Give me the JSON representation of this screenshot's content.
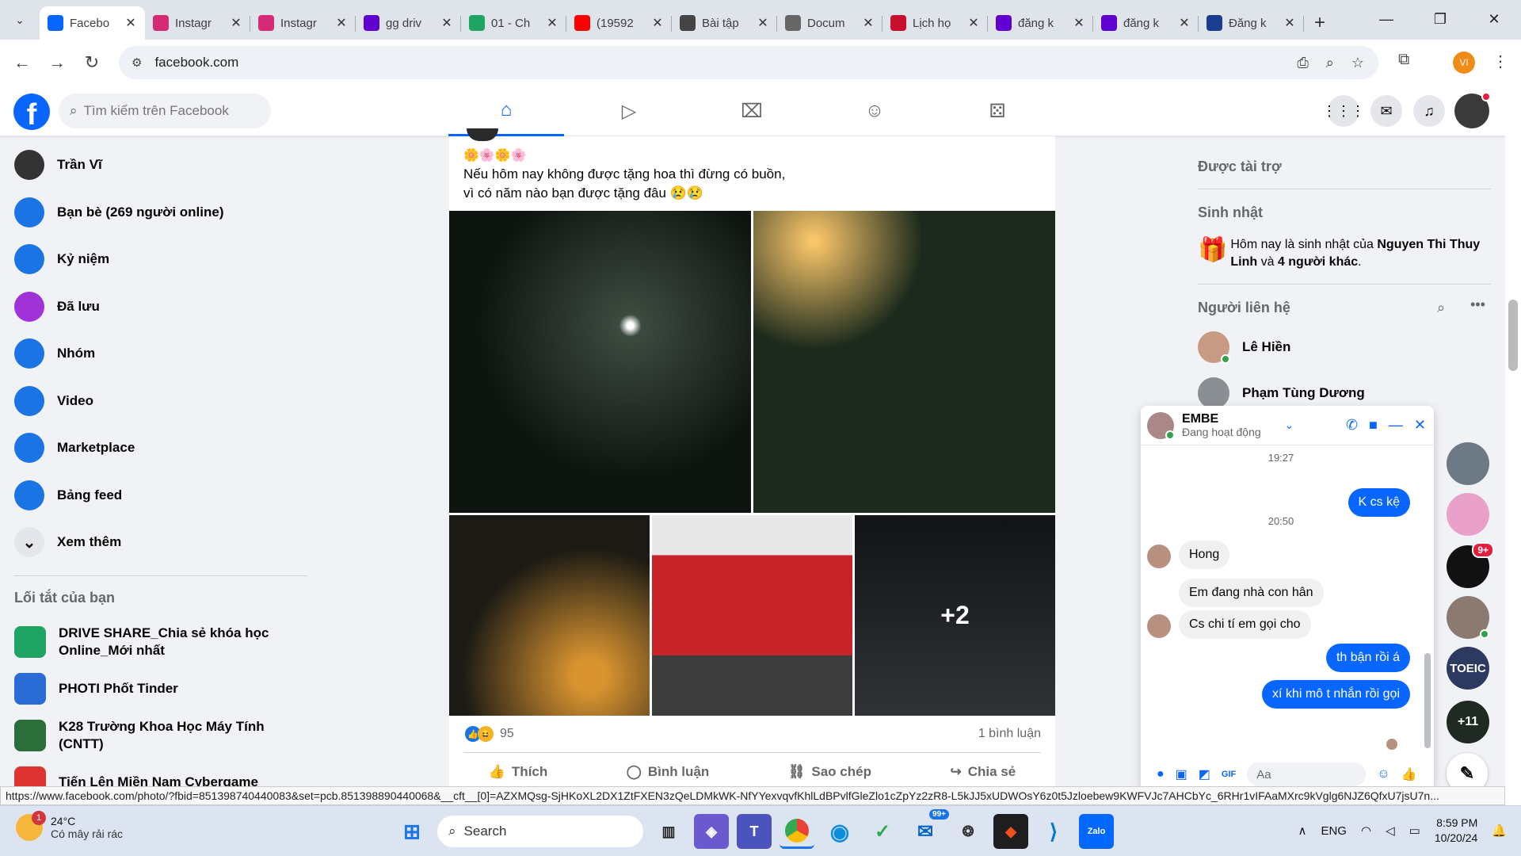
{
  "browser": {
    "tabs": [
      {
        "title": "Facebo",
        "icon": "facebook-icon",
        "color": "#0866ff",
        "active": true
      },
      {
        "title": "Instagr",
        "icon": "instagram-icon",
        "color": "#d62976"
      },
      {
        "title": "Instagr",
        "icon": "instagram-icon",
        "color": "#d62976"
      },
      {
        "title": "gg driv",
        "icon": "yahoo-icon",
        "color": "#6001d2"
      },
      {
        "title": "01 - Ch",
        "icon": "drive-icon",
        "color": "#1fa463"
      },
      {
        "title": "(19592",
        "icon": "youtube-icon",
        "color": "#ff0000"
      },
      {
        "title": "Bài tập",
        "icon": "openai-icon",
        "color": "#444444"
      },
      {
        "title": "Docum",
        "icon": "globe-icon",
        "color": "#666666"
      },
      {
        "title": "Lịch họ",
        "icon": "calendar-icon",
        "color": "#c8102e"
      },
      {
        "title": "đăng k",
        "icon": "yahoo-icon",
        "color": "#6001d2"
      },
      {
        "title": "đăng k",
        "icon": "yahoo-icon",
        "color": "#6001d2"
      },
      {
        "title": "Đăng k",
        "icon": "site-icon",
        "color": "#1a3d8f"
      }
    ],
    "url": "facebook.com",
    "profile_initial": "VI",
    "status_url": "https://www.facebook.com/photo/?fbid=851398740440083&set=pcb.851398890440068&__cft__[0]=AZXMQsg-SjHKoXL2DX1ZtFXEN3zQeLDMkWK-NfYYexvqvfKhlLdBPvlfGleZlo1cZpYz2zR8-L5kJJ5xUDWOsY6z0t5Jzloebew9KWFVJc7AHCbYc_6RHr1vIFAaMXrc9kVglg6NJZ6QfxU7jsU7n..."
  },
  "fb": {
    "search_placeholder": "Tìm kiếm trên Facebook",
    "nav": [
      "home-icon",
      "video-icon",
      "marketplace-icon",
      "groups-icon",
      "gaming-icon"
    ]
  },
  "left_nav": {
    "items": [
      {
        "label": "Trần Vĩ",
        "icon": "profile-avatar",
        "color": "#333333"
      },
      {
        "label": "Bạn bè (269 người online)",
        "icon": "friends-icon",
        "color": "#1b74e4"
      },
      {
        "label": "Kỷ niệm",
        "icon": "memories-icon",
        "color": "#1b74e4"
      },
      {
        "label": "Đã lưu",
        "icon": "saved-icon",
        "color": "#a033d8"
      },
      {
        "label": "Nhóm",
        "icon": "groups-icon",
        "color": "#1b74e4"
      },
      {
        "label": "Video",
        "icon": "video-icon",
        "color": "#1b74e4"
      },
      {
        "label": "Marketplace",
        "icon": "marketplace-icon",
        "color": "#1b74e4"
      },
      {
        "label": "Bảng feed",
        "icon": "feeds-icon",
        "color": "#1b74e4"
      },
      {
        "label": "Xem thêm",
        "icon": "chevron-down-icon",
        "color": "#e4e6eb"
      }
    ],
    "shortcuts_title": "Lối tắt của bạn",
    "shortcuts": [
      {
        "label": "DRIVE SHARE_Chia sẻ khóa học Online_Mới nhất",
        "color": "#1fa463"
      },
      {
        "label": "PHOTI Phốt Tinder",
        "color": "#2a6bd6"
      },
      {
        "label": "K28 Trường Khoa Học Máy Tính (CNTT)",
        "color": "#2c6e3a"
      },
      {
        "label": "Tiến Lên Miền Nam Cybergame",
        "color": "#d33"
      }
    ]
  },
  "post": {
    "emoji": "🌼🌸🌼🌸",
    "caption_line1": "Nếu hôm nay không được tặng hoa thì đừng có buồn,",
    "caption_line2": "vì có năm nào bạn được tặng đâu 😢😢",
    "more_photos": "+2",
    "reaction_count": "95",
    "comments": "1 bình luận",
    "actions": [
      {
        "label": "Thích",
        "icon": "like-icon"
      },
      {
        "label": "Bình luận",
        "icon": "comment-icon"
      },
      {
        "label": "Sao chép",
        "icon": "copy-link-icon"
      },
      {
        "label": "Chia sẻ",
        "icon": "share-icon"
      }
    ]
  },
  "right": {
    "sponsored": "Được tài trợ",
    "birthdays": "Sinh nhật",
    "birthday_text_1": "Hôm nay là sinh nhật của ",
    "birthday_name": "Nguyen Thi Thuy Linh",
    "birthday_text_2": " và ",
    "birthday_others": "4 người khác",
    "birthday_text_3": ".",
    "contacts_title": "Người liên hệ",
    "contacts": [
      {
        "name": "Lê Hiền",
        "online": true
      },
      {
        "name": "Phạm Tùng Dương",
        "online": false
      }
    ]
  },
  "chat": {
    "name": "EMBE",
    "status": "Đang hoạt động",
    "messages": [
      {
        "type": "time",
        "text": "19:27"
      },
      {
        "type": "me",
        "text": "K cs kệ"
      },
      {
        "type": "time",
        "text": "20:50"
      },
      {
        "type": "them",
        "text": "Hong"
      },
      {
        "type": "them",
        "text": "Em đang nhà con hân"
      },
      {
        "type": "them",
        "text": "Cs chi tí em gọi cho"
      },
      {
        "type": "me",
        "text": "th bận rồi á"
      },
      {
        "type": "me",
        "text": "xí khi mô t nhắn rồi gọi"
      }
    ],
    "input_placeholder": "Aa"
  },
  "rail": {
    "badge": "9+",
    "toeic": "TOEIC",
    "more": "+11"
  },
  "taskbar": {
    "temp": "24°C",
    "weather": "Có mây rải rác",
    "weather_badge": "1",
    "search": "Search",
    "mail_badge": "99+",
    "zalo": "Zalo",
    "lang": "ENG",
    "time": "8:59 PM",
    "date": "10/20/24"
  }
}
